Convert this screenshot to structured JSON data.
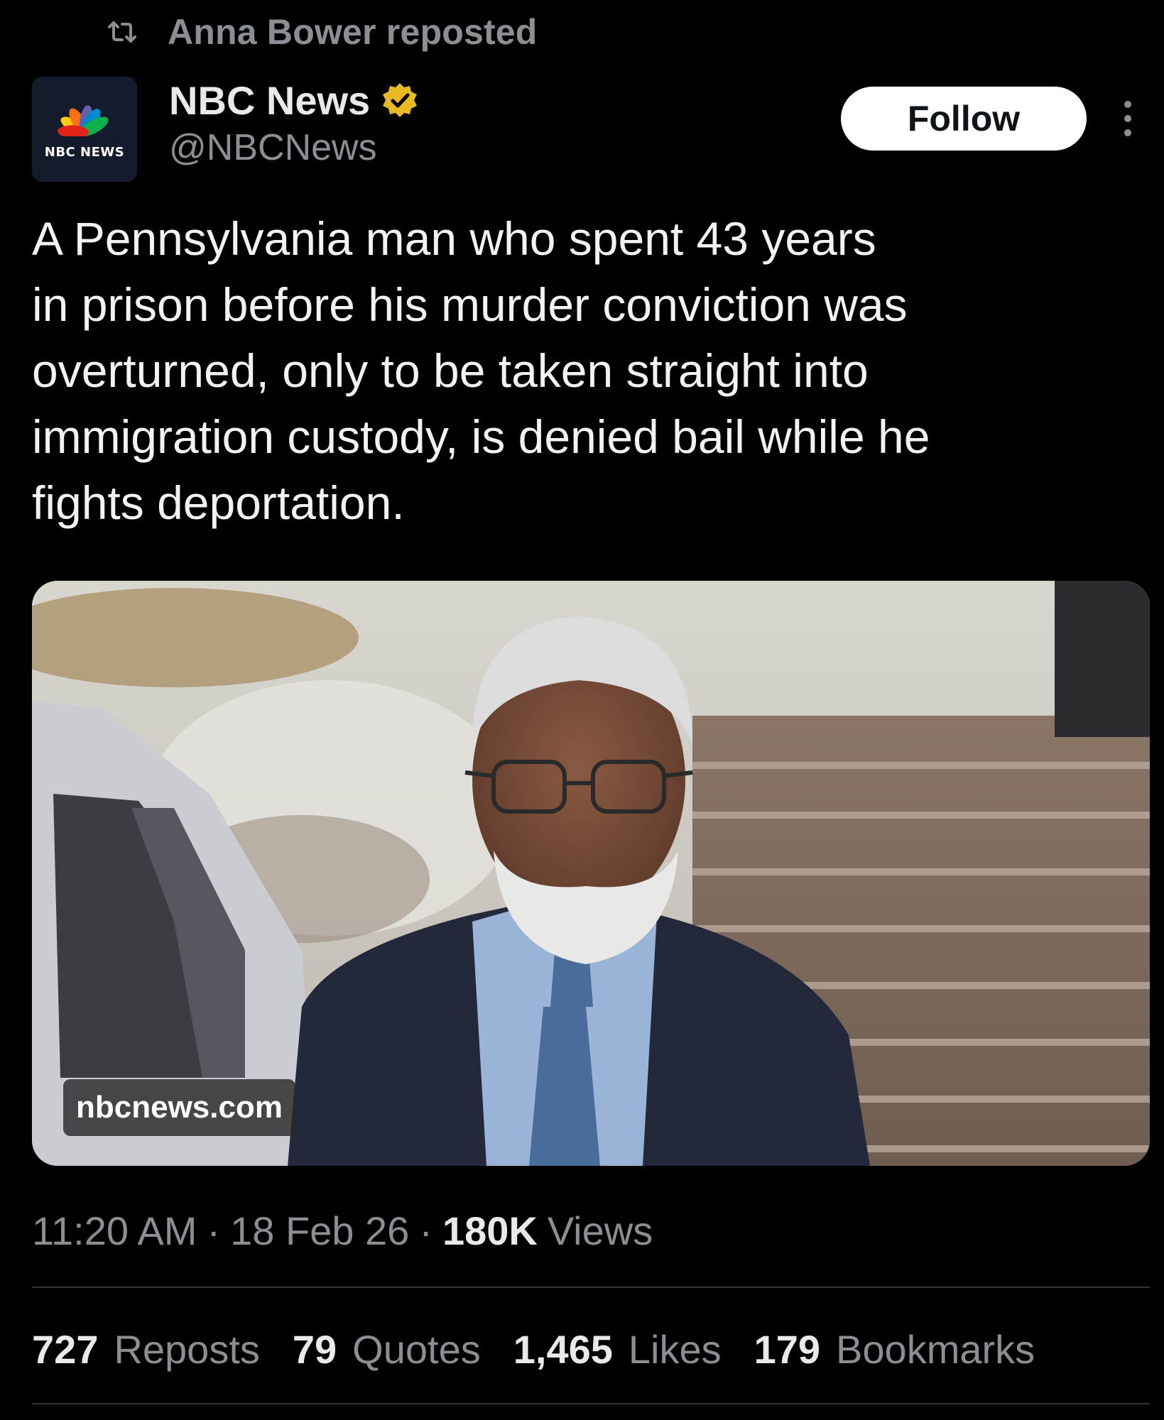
{
  "repost_header": {
    "icon": "repost-icon",
    "text": "Anna Bower reposted"
  },
  "author": {
    "avatar_icon": "nbc-peacock-logo",
    "avatar_brand_text": "NBC NEWS",
    "display_name": "NBC News",
    "verified_icon": "verified-badge-gold-icon",
    "handle": "@NBCNews"
  },
  "actions": {
    "follow_label": "Follow",
    "more_icon": "more-vertical-icon"
  },
  "tweet": {
    "text_lines": [
      "A Pennsylvania man who spent 43 years",
      "in prison before his murder conviction was",
      "overturned, only to be taken straight into",
      "immigration custody, is denied bail while he",
      "fights deportation."
    ]
  },
  "media": {
    "domain_badge": "nbcnews.com"
  },
  "meta": {
    "time": "11:20 AM",
    "separator": "·",
    "date": "18 Feb 26",
    "views_count": "180K",
    "views_label": "Views"
  },
  "stats": {
    "reposts": {
      "count": "727",
      "label": "Reposts"
    },
    "quotes": {
      "count": "79",
      "label": "Quotes"
    },
    "likes": {
      "count": "1,465",
      "label": "Likes"
    },
    "bookmarks": {
      "count": "179",
      "label": "Bookmarks"
    }
  },
  "colors": {
    "background": "#000000",
    "primary_text": "#e7e9ea",
    "secondary_text": "#8b8f94",
    "verified_gold": "#e8b923",
    "divider": "#2f3336"
  }
}
